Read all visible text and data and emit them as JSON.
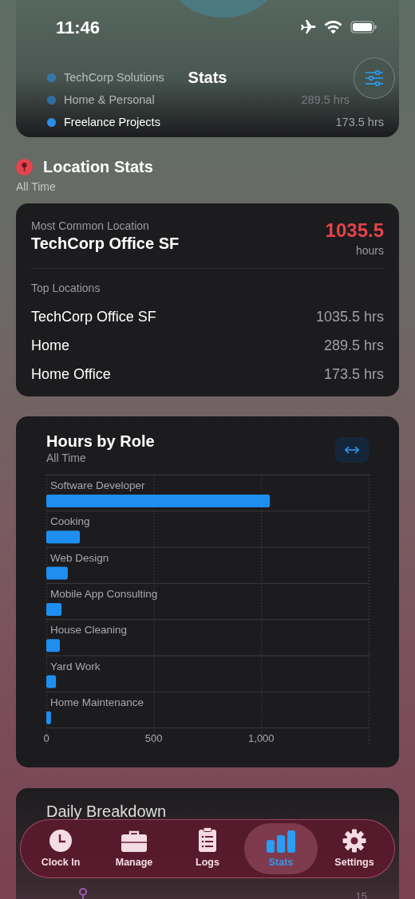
{
  "status_bar": {
    "time": "11:46"
  },
  "nav": {
    "title": "Stats"
  },
  "legend": [
    {
      "name": "TechCorp Solutions",
      "faded": true
    },
    {
      "name": "Home & Personal",
      "value": "289.5 hrs",
      "faded": true
    },
    {
      "name": "Freelance Projects",
      "value": "173.5 hrs",
      "faded": false
    }
  ],
  "location_stats": {
    "title": "Location Stats",
    "subtitle": "All Time",
    "most_common_label": "Most Common Location",
    "most_common_name": "TechCorp Office SF",
    "most_common_value": "1035.5",
    "most_common_unit": "hours",
    "top_label": "Top Locations",
    "top_locations": [
      {
        "name": "TechCorp Office SF",
        "value": "1035.5 hrs"
      },
      {
        "name": "Home",
        "value": "289.5 hrs"
      },
      {
        "name": "Home Office",
        "value": "173.5 hrs"
      }
    ]
  },
  "hours_by_role": {
    "title": "Hours by Role",
    "subtitle": "All Time",
    "chart_data": {
      "type": "bar",
      "orientation": "horizontal",
      "categories": [
        "Software Developer",
        "Cooking",
        "Web Design",
        "Mobile App Consulting",
        "House Cleaning",
        "Yard Work",
        "Home Maintenance"
      ],
      "series": [
        {
          "color": "#1e8ff0",
          "values": [
            1040,
            156,
            100,
            71,
            63,
            45,
            22
          ]
        }
      ],
      "xlim": [
        0,
        1500
      ],
      "xticks": [
        0,
        {
          "value": 500,
          "label": "500"
        },
        {
          "value": 1000,
          "label": "1,000"
        }
      ]
    }
  },
  "daily_breakdown": {
    "title": "Daily Breakdown",
    "tick": "15"
  },
  "tabs": [
    {
      "label": "Clock In",
      "selected": false
    },
    {
      "label": "Manage",
      "selected": false
    },
    {
      "label": "Logs",
      "selected": false
    },
    {
      "label": "Stats",
      "selected": true
    },
    {
      "label": "Settings",
      "selected": false
    }
  ]
}
